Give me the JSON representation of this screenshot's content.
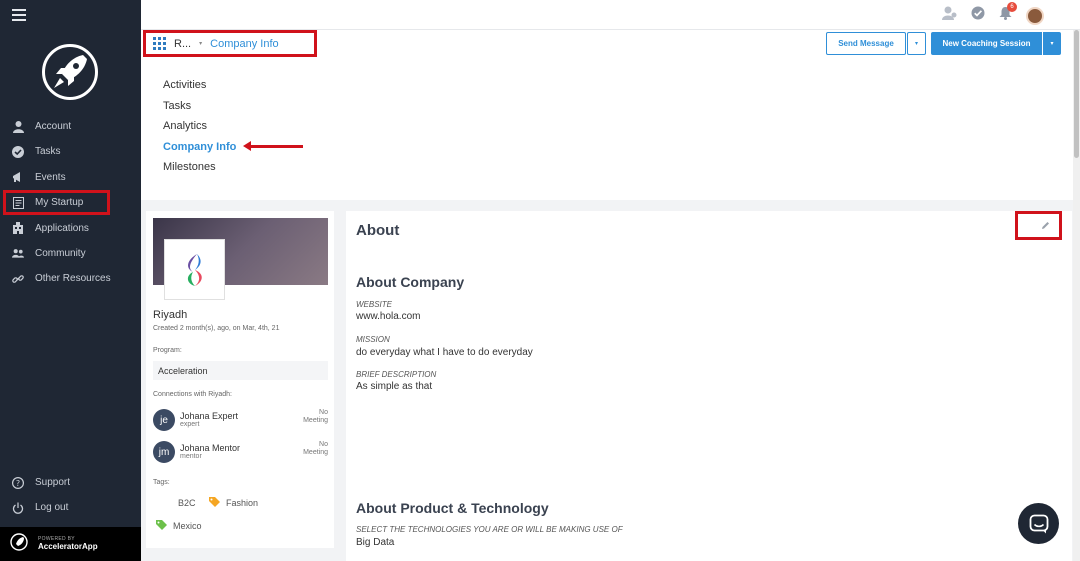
{
  "sidebar": {
    "items": [
      {
        "label": "Account",
        "icon": "user-icon"
      },
      {
        "label": "Tasks",
        "icon": "check-circle-icon"
      },
      {
        "label": "Events",
        "icon": "megaphone-icon"
      },
      {
        "label": "My Startup",
        "icon": "document-icon"
      },
      {
        "label": "Applications",
        "icon": "building-icon"
      },
      {
        "label": "Community",
        "icon": "users-icon"
      },
      {
        "label": "Other Resources",
        "icon": "link-icon"
      }
    ],
    "bottom": [
      {
        "label": "Support",
        "icon": "question-icon"
      },
      {
        "label": "Log out",
        "icon": "power-icon"
      }
    ],
    "powered_small": "POWERED BY",
    "powered_big": "AcceleratorApp"
  },
  "topbar": {
    "notification_count": "6"
  },
  "header": {
    "breadcrumb_short": "R...",
    "breadcrumb_active": "Company Info",
    "send_message": "Send Message",
    "new_coaching": "New Coaching Session",
    "dropdown_caret": "▾"
  },
  "subnav": {
    "items": [
      "Activities",
      "Tasks",
      "Analytics",
      "Company Info",
      "Milestones"
    ]
  },
  "company": {
    "name": "Riyadh",
    "created": "Created 2 month(s), ago, on Mar, 4th, 21",
    "program_label": "Program:",
    "program": "Acceleration",
    "connections_label": "Connections with Riyadh:",
    "connections": [
      {
        "initials": "je",
        "name": "Johana Expert",
        "role": "expert",
        "meeting_1": "No",
        "meeting_2": "Meeting"
      },
      {
        "initials": "jm",
        "name": "Johana Mentor",
        "role": "mentor",
        "meeting_1": "No",
        "meeting_2": "Meeting"
      }
    ],
    "tags_label": "Tags:",
    "tags": [
      "B2C",
      "Fashion",
      "Mexico"
    ]
  },
  "about": {
    "title": "About",
    "company_section": "About Company",
    "website_label": "WEBSITE",
    "website": "www.hola.com",
    "mission_label": "MISSION",
    "mission": "do everyday what I have to do everyday",
    "brief_label": "BRIEF DESCRIPTION",
    "brief": "As simple as that",
    "product_section": "About Product & Technology",
    "tech_label": "SELECT THE TECHNOLOGIES YOU ARE OR WILL BE MAKING USE OF",
    "tech": "Big Data"
  },
  "colors": {
    "accent": "#2f8fd8",
    "sidebar_bg": "#1f2734",
    "highlight_red": "#d0121b"
  }
}
